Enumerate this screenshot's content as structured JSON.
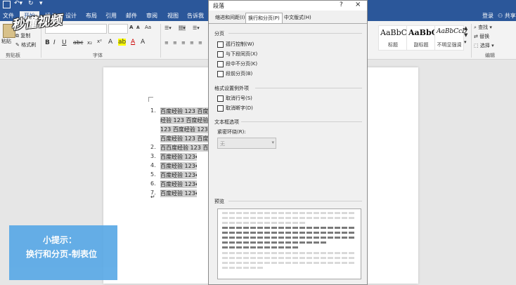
{
  "window": {
    "minimize_icon": "?",
    "close_icon": "×"
  },
  "ribbon": {
    "tabs": [
      "文件",
      "开始",
      "插入",
      "设计",
      "布局",
      "引用",
      "邮件",
      "审阅",
      "视图",
      "告诉我"
    ],
    "clipboard": {
      "paste": "粘贴",
      "copy": "复制",
      "format_painter": "格式刷",
      "group": "剪贴板"
    },
    "font_group": "字体",
    "styles": [
      {
        "preview": "AaBbC",
        "name": "标题"
      },
      {
        "preview": "AaBbC",
        "name": "副标题"
      },
      {
        "preview": "AaBbCcD",
        "name": "不明显强调"
      }
    ],
    "editing": {
      "find": "查找",
      "replace": "替换",
      "select": "选择",
      "group": "编辑"
    },
    "login": "登录",
    "share": "共享"
  },
  "watermark": "秒懂视频",
  "document": {
    "numbers": [
      "1.",
      "",
      "",
      "",
      "2.",
      "3.",
      "4.",
      "5.",
      "6.",
      "7."
    ],
    "lines": [
      "百度经验 123 百度经",
      "经验 123 百度经验 1",
      "123 百度经验 123 百",
      "百度经验 123 百度经",
      "百百度经验 123 百度经",
      "百度经验 123↵",
      "百度经验 123↵",
      "百度经验 123↵",
      "百度经验 123↵",
      "百度经验 123↵"
    ]
  },
  "tip": {
    "title": "小提示：",
    "body": "换行和分页-制表位"
  },
  "dialog": {
    "title": "段落",
    "tabs": [
      "缩进和间距(I)",
      "换行和分页(P)",
      "中文版式(H)"
    ],
    "pagination": {
      "label": "分页",
      "options": [
        {
          "label": "孤行控制(W)",
          "checked": false
        },
        {
          "label": "与下段同页(X)",
          "checked": false
        },
        {
          "label": "段中不分页(K)",
          "checked": false
        },
        {
          "label": "段前分页(B)",
          "checked": false
        }
      ]
    },
    "exceptions": {
      "label": "格式设置例外项",
      "options": [
        {
          "label": "取消行号(S)",
          "checked": false
        },
        {
          "label": "取消断字(D)",
          "checked": false
        }
      ]
    },
    "textbox": {
      "label": "文本框选项",
      "wrap_label": "紧密环绕(R):",
      "wrap_value": "无"
    },
    "preview_label": "预览"
  }
}
